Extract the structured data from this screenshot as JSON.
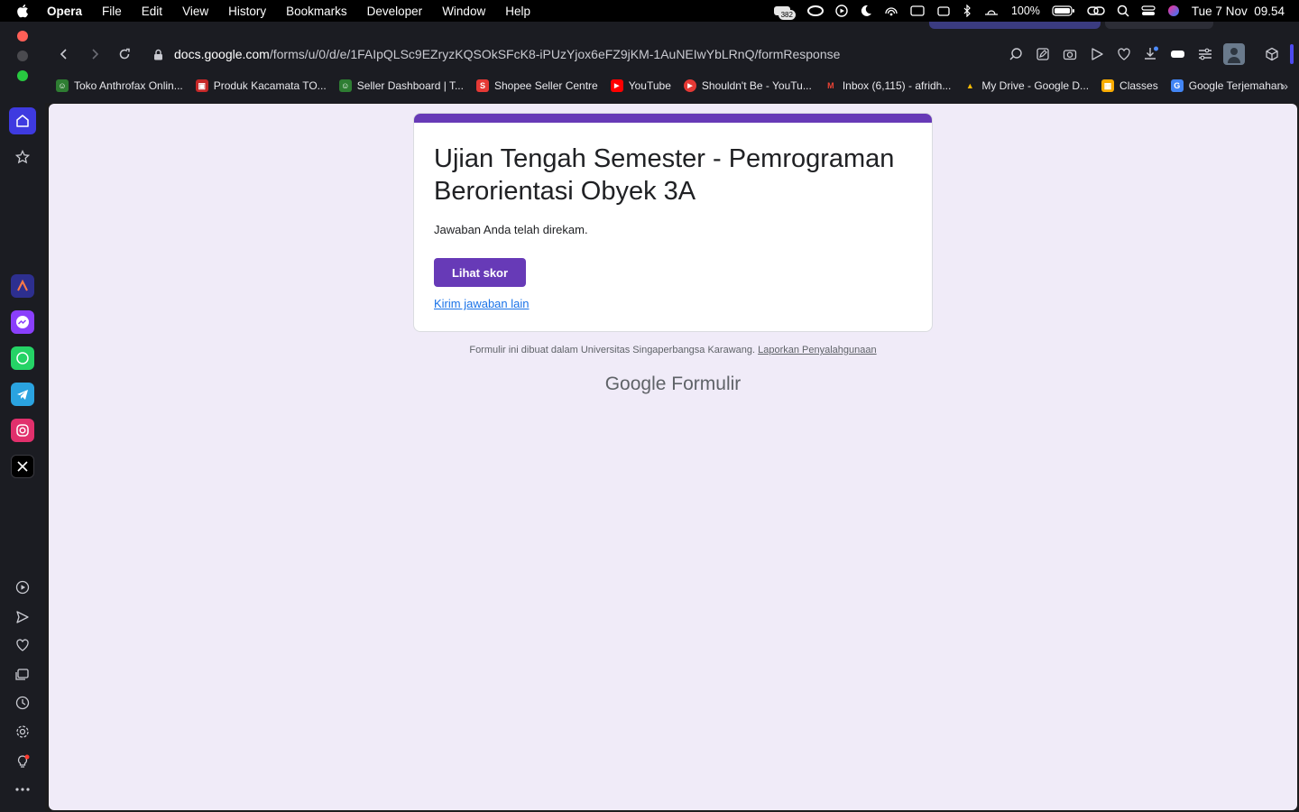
{
  "menubar": {
    "app_name": "Opera",
    "items": [
      "File",
      "Edit",
      "View",
      "History",
      "Bookmarks",
      "Developer",
      "Window",
      "Help"
    ],
    "badge_count": "382",
    "battery": "100%",
    "clock": "Tue 7 Nov  09.54"
  },
  "browser": {
    "url_host": "docs.google.com",
    "url_path": "/forms/u/0/d/e/1FAIpQLSc9EZryzKQSOkSFcK8-iPUzYjox6eFZ9jKM-1AuNEIwYbLRnQ/formResponse",
    "bookmarks": [
      {
        "label": "Toko Anthrofax Onlin...",
        "color": "#2e7d32",
        "glyph": "☺"
      },
      {
        "label": "Produk Kacamata TO...",
        "color": "#c62828",
        "glyph": "▣"
      },
      {
        "label": "Seller Dashboard | T...",
        "color": "#2e7d32",
        "glyph": "☺"
      },
      {
        "label": "Shopee Seller Centre",
        "color": "#e53935",
        "glyph": "S"
      },
      {
        "label": "YouTube",
        "color": "#ff0000",
        "glyph": "▶"
      },
      {
        "label": "Shouldn't Be - YouTu...",
        "color": "#e53935",
        "glyph": "▶"
      },
      {
        "label": "Inbox (6,115) - afridh...",
        "color": "#ffffff",
        "glyph": "M"
      },
      {
        "label": "My Drive - Google D...",
        "color": "#1e8e3e",
        "glyph": "▲"
      },
      {
        "label": "Classes",
        "color": "#f9ab00",
        "glyph": "▦"
      },
      {
        "label": "Google Terjemahan",
        "color": "#4285f4",
        "glyph": "G"
      }
    ],
    "more_glyph": "»"
  },
  "form": {
    "title": "Ujian Tengah Semester - Pemrograman Berorientasi Obyek 3A",
    "confirmation": "Jawaban Anda telah direkam.",
    "score_button": "Lihat skor",
    "resubmit_link": "Kirim jawaban lain",
    "footer_text": "Formulir ini dibuat dalam Universitas Singaperbangsa Karawang.",
    "report_link": "Laporkan Penyalahgunaan",
    "brand_google": "Google",
    "brand_product": "Formulir",
    "accent_color": "#673ab7"
  }
}
